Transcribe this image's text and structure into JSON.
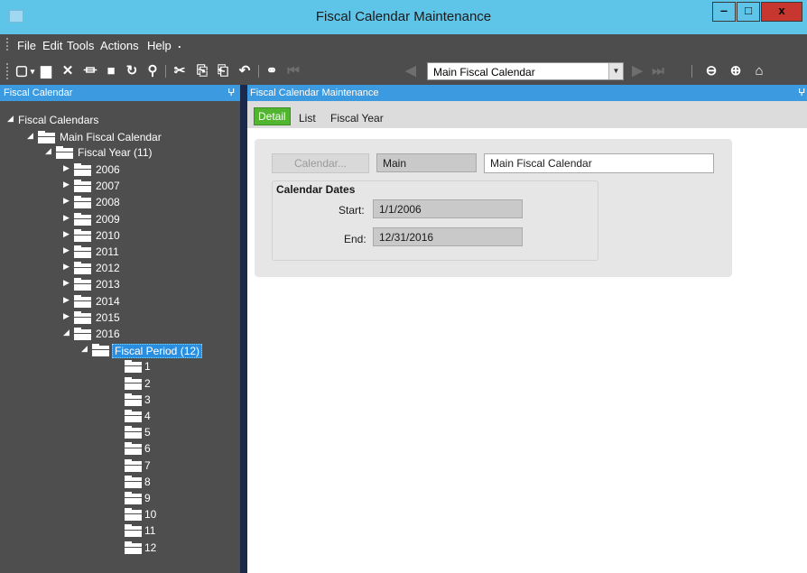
{
  "window": {
    "title": "Fiscal Calendar Maintenance",
    "minimize": "‒",
    "maximize": "□",
    "close": "x"
  },
  "menu": {
    "items": [
      "File",
      "Edit",
      "Tools",
      "Actions",
      "Help"
    ],
    "overflow": "."
  },
  "toolbar": {
    "selector_value": "Main Fiscal Calendar",
    "icons": [
      "new-icon",
      "save-icon",
      "delete-icon",
      "search-icon",
      "stop-icon",
      "refresh-icon",
      "clear-icon",
      "cut-icon",
      "copy-icon",
      "paste-icon",
      "undo-icon",
      "binoculars-icon",
      "first-record-icon",
      "prev-record-icon",
      "next-record-icon",
      "last-record-icon",
      "back-icon",
      "forward-icon",
      "home-icon"
    ]
  },
  "left_pane": {
    "title": "Fiscal Calendar",
    "pin": "ⵖ",
    "tree": [
      {
        "label": "Fiscal Calendars",
        "level": 0,
        "expand": "◢",
        "folder": false
      },
      {
        "label": "Main Fiscal Calendar",
        "level": 1,
        "expand": "◢",
        "folder": true
      },
      {
        "label": "Fiscal Year (11)",
        "level": 2,
        "expand": "◢",
        "folder": true
      },
      {
        "label": "2006",
        "level": 3,
        "expand": "▶",
        "folder": true
      },
      {
        "label": "2007",
        "level": 3,
        "expand": "▶",
        "folder": true
      },
      {
        "label": "2008",
        "level": 3,
        "expand": "▶",
        "folder": true
      },
      {
        "label": "2009",
        "level": 3,
        "expand": "▶",
        "folder": true
      },
      {
        "label": "2010",
        "level": 3,
        "expand": "▶",
        "folder": true
      },
      {
        "label": "2011",
        "level": 3,
        "expand": "▶",
        "folder": true
      },
      {
        "label": "2012",
        "level": 3,
        "expand": "▶",
        "folder": true
      },
      {
        "label": "2013",
        "level": 3,
        "expand": "▶",
        "folder": true
      },
      {
        "label": "2014",
        "level": 3,
        "expand": "▶",
        "folder": true
      },
      {
        "label": "2015",
        "level": 3,
        "expand": "▶",
        "folder": true
      },
      {
        "label": "2016",
        "level": 3,
        "expand": "◢",
        "folder": true
      },
      {
        "label": "Fiscal Period (12)",
        "level": 4,
        "expand": "◢",
        "folder": true,
        "selected": true
      },
      {
        "label": "1",
        "level": 5,
        "expand": "",
        "folder": true
      },
      {
        "label": "2",
        "level": 5,
        "expand": "",
        "folder": true
      },
      {
        "label": "3",
        "level": 5,
        "expand": "",
        "folder": true
      },
      {
        "label": "4",
        "level": 5,
        "expand": "",
        "folder": true
      },
      {
        "label": "5",
        "level": 5,
        "expand": "",
        "folder": true
      },
      {
        "label": "6",
        "level": 5,
        "expand": "",
        "folder": true
      },
      {
        "label": "7",
        "level": 5,
        "expand": "",
        "folder": true
      },
      {
        "label": "8",
        "level": 5,
        "expand": "",
        "folder": true
      },
      {
        "label": "9",
        "level": 5,
        "expand": "",
        "folder": true
      },
      {
        "label": "10",
        "level": 5,
        "expand": "",
        "folder": true
      },
      {
        "label": "11",
        "level": 5,
        "expand": "",
        "folder": true
      },
      {
        "label": "12",
        "level": 5,
        "expand": "",
        "folder": true
      }
    ]
  },
  "right_pane": {
    "title": "Fiscal Calendar Maintenance",
    "pin": "ⵖ",
    "tabs": [
      {
        "label": "Detail",
        "active": true
      },
      {
        "label": "List",
        "active": false
      },
      {
        "label": "Fiscal Year",
        "active": false
      }
    ],
    "form": {
      "calendar_button": "Calendar...",
      "calendar_id": "Main",
      "calendar_description": "Main Fiscal Calendar",
      "group_title": "Calendar Dates",
      "start_label": "Start:",
      "start_value": "1/1/2006",
      "end_label": "End:",
      "end_value": "12/31/2016"
    }
  },
  "colors": {
    "accent": "#3c9be0",
    "titlebar": "#5ec4e8",
    "active_tab": "#52b530",
    "chrome": "#4d4d4d"
  }
}
